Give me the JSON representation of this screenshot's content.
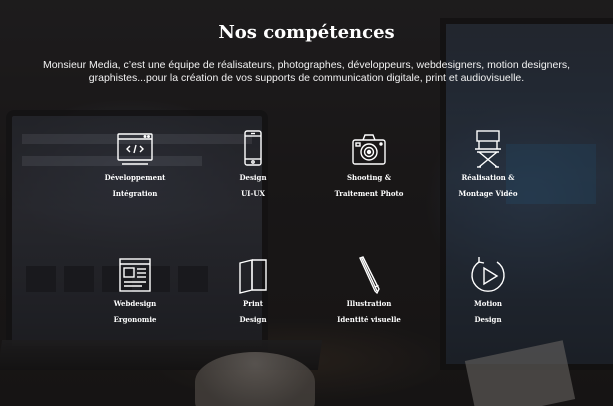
{
  "section": {
    "title": "Nos compétences",
    "intro": "Monsieur Media, c’est une équipe de réalisateurs, photographes, développeurs, webdesigners, motion designers, graphistes...pour la création de vos supports de communication digitale, print et audiovisuelle."
  },
  "skills": [
    {
      "icon": "code-window-icon",
      "line1": "Développement",
      "line2": "Intégration"
    },
    {
      "icon": "smartphone-icon",
      "line1": "Design",
      "line2": "UI-UX"
    },
    {
      "icon": "camera-icon",
      "line1": "Shooting &",
      "line2": "Traitement Photo"
    },
    {
      "icon": "director-chair-icon",
      "line1": "Réalisation &",
      "line2": "Montage Vidéo"
    },
    {
      "icon": "webpage-layout-icon",
      "line1": "Webdesign",
      "line2": "Ergonomie"
    },
    {
      "icon": "print-pages-icon",
      "line1": "Print",
      "line2": "Design"
    },
    {
      "icon": "pencil-icon",
      "line1": "Illustration",
      "line2": "Identité visuelle"
    },
    {
      "icon": "play-circle-icon",
      "line1": "Motion",
      "line2": "Design"
    }
  ]
}
